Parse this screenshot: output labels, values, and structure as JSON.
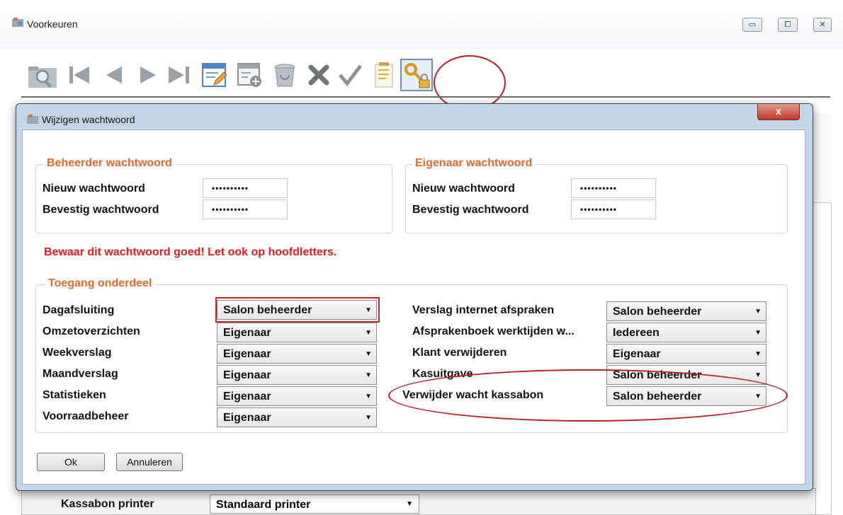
{
  "main_window": {
    "title": "Voorkeuren",
    "window_buttons": [
      "▭",
      "⧠",
      "✕"
    ]
  },
  "toolbar": {
    "items": [
      "search-icon",
      "first-record-icon",
      "previous-record-icon",
      "next-record-icon",
      "last-record-icon",
      "edit-icon",
      "new-record-icon",
      "delete-icon",
      "cancel-icon",
      "confirm-icon",
      "notes-icon",
      "keys-lock-icon"
    ]
  },
  "background": {
    "label": "Kassabon printer",
    "select_value": "Standaard printer"
  },
  "dialog": {
    "title": "Wijzigen wachtwoord",
    "close": "x",
    "admin_group": {
      "title": "Beheerder wachtwoord",
      "new_label": "Nieuw wachtwoord",
      "new_value": "••••••••••",
      "confirm_label": "Bevestig wachtwoord",
      "confirm_value": "••••••••••"
    },
    "owner_group": {
      "title": "Eigenaar wachtwoord",
      "new_label": "Nieuw wachtwoord",
      "new_value": "••••••••••",
      "confirm_label": "Bevestig wachtwoord",
      "confirm_value": "••••••••••"
    },
    "warning": "Bewaar dit wachtwoord goed! Let ook op hoofdletters.",
    "access_group": {
      "title": "Toegang onderdeel",
      "left": [
        {
          "label": "Dagafsluiting",
          "value": "Salon beheerder"
        },
        {
          "label": "Omzetoverzichten",
          "value": "Eigenaar"
        },
        {
          "label": "Weekverslag",
          "value": "Eigenaar"
        },
        {
          "label": "Maandverslag",
          "value": "Eigenaar"
        },
        {
          "label": "Statistieken",
          "value": "Eigenaar"
        },
        {
          "label": "Voorraadbeheer",
          "value": "Eigenaar"
        }
      ],
      "right": [
        {
          "label": "Verslag internet afspraken",
          "value": "Salon beheerder"
        },
        {
          "label": "Afsprakenboek werktijden w...",
          "value": "Iedereen"
        },
        {
          "label": "Klant verwijderen",
          "value": "Eigenaar"
        },
        {
          "label": "Kasuitgave",
          "value": "Salon beheerder"
        },
        {
          "label": "Verwijder wacht kassabon",
          "value": "Salon beheerder"
        }
      ]
    },
    "ok_label": "Ok",
    "cancel_label": "Annuleren"
  },
  "colors": {
    "group_title": "#e06a2c",
    "warning": "#e8191b",
    "annotation": "#b31f24"
  }
}
